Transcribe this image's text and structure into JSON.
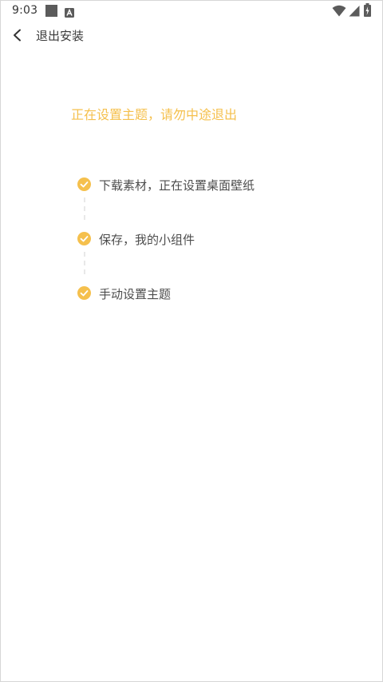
{
  "status_bar": {
    "time": "9:03",
    "icons": [
      "notification-square-icon",
      "app-a-icon",
      "wifi-icon",
      "signal-icon",
      "battery-charging-icon"
    ]
  },
  "header": {
    "back_icon": "chevron-left-icon",
    "title": "退出安装"
  },
  "headline": "正在设置主题，请勿中途退出",
  "steps": [
    {
      "label": "下载素材，正在设置桌面壁纸",
      "status": "done"
    },
    {
      "label": "保存，我的小组件",
      "status": "done"
    },
    {
      "label": "手动设置主题",
      "status": "done"
    }
  ],
  "colors": {
    "accent": "#f5c04d",
    "text": "#4d4d4d",
    "title": "#3a3a3a"
  }
}
